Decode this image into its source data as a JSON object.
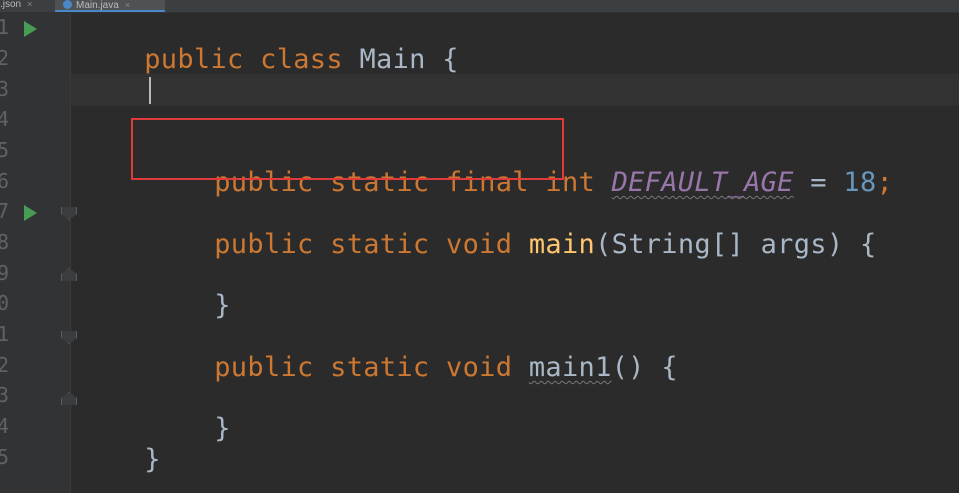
{
  "tabs": [
    {
      "label": ".json",
      "close": "×"
    },
    {
      "label": "Main.java",
      "close": "×"
    }
  ],
  "gutter": {
    "line_numbers": [
      "1",
      "2",
      "3",
      "4",
      "5",
      "6",
      "7",
      "8",
      "9",
      "0",
      "1",
      "2",
      "3",
      "4",
      "5"
    ]
  },
  "code": {
    "line1": {
      "kw1": "public",
      "kw2": "class",
      "name": "Main",
      "brace": "{"
    },
    "line5": {
      "kw1": "public",
      "kw2": "static",
      "kw3": "final",
      "kw4": "int",
      "const": "DEFAULT_AGE",
      "eq": "=",
      "value": "18",
      "semi": ";"
    },
    "line7": {
      "kw1": "public",
      "kw2": "static",
      "kw3": "void",
      "fn": "main",
      "params": "(String[] args)",
      "brace": "{"
    },
    "line9": {
      "brace": "}"
    },
    "line11": {
      "kw1": "public",
      "kw2": "static",
      "kw3": "void",
      "fn": "main1",
      "params": "()",
      "brace": "{"
    },
    "line13": {
      "brace": "}"
    },
    "line14": {
      "brace": "}"
    }
  },
  "colors": {
    "background": "#2b2b2b",
    "keyword": "#cc7832",
    "function": "#ffc66d",
    "number": "#6897bb",
    "constant": "#9876aa",
    "text": "#a9b7c6",
    "highlight_box": "#e03a3a",
    "run_icon": "#499c54"
  },
  "icons": [
    "run-icon",
    "fold-icon",
    "close-icon",
    "java-class-icon"
  ]
}
